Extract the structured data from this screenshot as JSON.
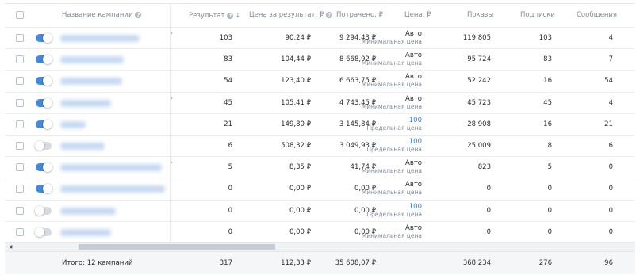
{
  "columns": {
    "name": "Название кампании",
    "result": "Результат",
    "cost_per_result": "Цена за результат, ₽",
    "spent": "Потрачено, ₽",
    "price": "Цена, ₽",
    "impressions": "Показы",
    "subscriptions": "Подписки",
    "messages": "Сообщения"
  },
  "rows": [
    {
      "enabled": true,
      "result": "103",
      "cost": "90,24 ₽",
      "spent": "9 294,43 ₽",
      "price": "Авто",
      "price_note": "Минимальная цена",
      "price_link": false,
      "impressions": "119 805",
      "subscriptions": "103",
      "messages": "4"
    },
    {
      "enabled": true,
      "result": "83",
      "cost": "104,44 ₽",
      "spent": "8 668,92 ₽",
      "price": "Авто",
      "price_note": "Минимальная цена",
      "price_link": false,
      "impressions": "95 724",
      "subscriptions": "83",
      "messages": "7"
    },
    {
      "enabled": true,
      "result": "54",
      "cost": "123,40 ₽",
      "spent": "6 663,75 ₽",
      "price": "Авто",
      "price_note": "Минимальная цена",
      "price_link": false,
      "impressions": "52 242",
      "subscriptions": "16",
      "messages": "54"
    },
    {
      "enabled": true,
      "result": "45",
      "cost": "105,41 ₽",
      "spent": "4 743,45 ₽",
      "price": "Авто",
      "price_note": "Минимальная цена",
      "price_link": false,
      "impressions": "45 723",
      "subscriptions": "45",
      "messages": "4"
    },
    {
      "enabled": true,
      "result": "21",
      "cost": "149,80 ₽",
      "spent": "3 145,84 ₽",
      "price": "100",
      "price_note": "Предельная цена",
      "price_link": true,
      "impressions": "28 908",
      "subscriptions": "16",
      "messages": "21"
    },
    {
      "enabled": false,
      "result": "6",
      "cost": "508,32 ₽",
      "spent": "3 049,93 ₽",
      "price": "100",
      "price_note": "Предельная цена",
      "price_link": true,
      "impressions": "25 009",
      "subscriptions": "8",
      "messages": "6"
    },
    {
      "enabled": true,
      "result": "5",
      "cost": "8,35 ₽",
      "spent": "41,74 ₽",
      "price": "Авто",
      "price_note": "Минимальная цена",
      "price_link": false,
      "impressions": "823",
      "subscriptions": "5",
      "messages": "0"
    },
    {
      "enabled": true,
      "result": "0",
      "cost": "0,00 ₽",
      "spent": "0,00 ₽",
      "price": "Авто",
      "price_note": "Минимальная цена",
      "price_link": false,
      "impressions": "0",
      "subscriptions": "0",
      "messages": "0"
    },
    {
      "enabled": false,
      "result": "0",
      "cost": "0,00 ₽",
      "spent": "0,00 ₽",
      "price": "100",
      "price_note": "Предельная цена",
      "price_link": true,
      "impressions": "0",
      "subscriptions": "0",
      "messages": "0"
    },
    {
      "enabled": false,
      "result": "0",
      "cost": "0,00 ₽",
      "spent": "0,00 ₽",
      "price": "Авто",
      "price_note": "Минимальная цена",
      "price_link": false,
      "impressions": "0",
      "subscriptions": "0",
      "messages": "0"
    }
  ],
  "footer": {
    "label": "Итого: 12 кампаний",
    "result": "317",
    "cost": "112,33 ₽",
    "spent": "35 608,07 ₽",
    "impressions": "368 234",
    "subscriptions": "276",
    "messages": "96"
  },
  "colors": {
    "toggle_on": "#3f8ae0",
    "toggle_off": "#d7dbe0",
    "link": "#2d81e0"
  }
}
